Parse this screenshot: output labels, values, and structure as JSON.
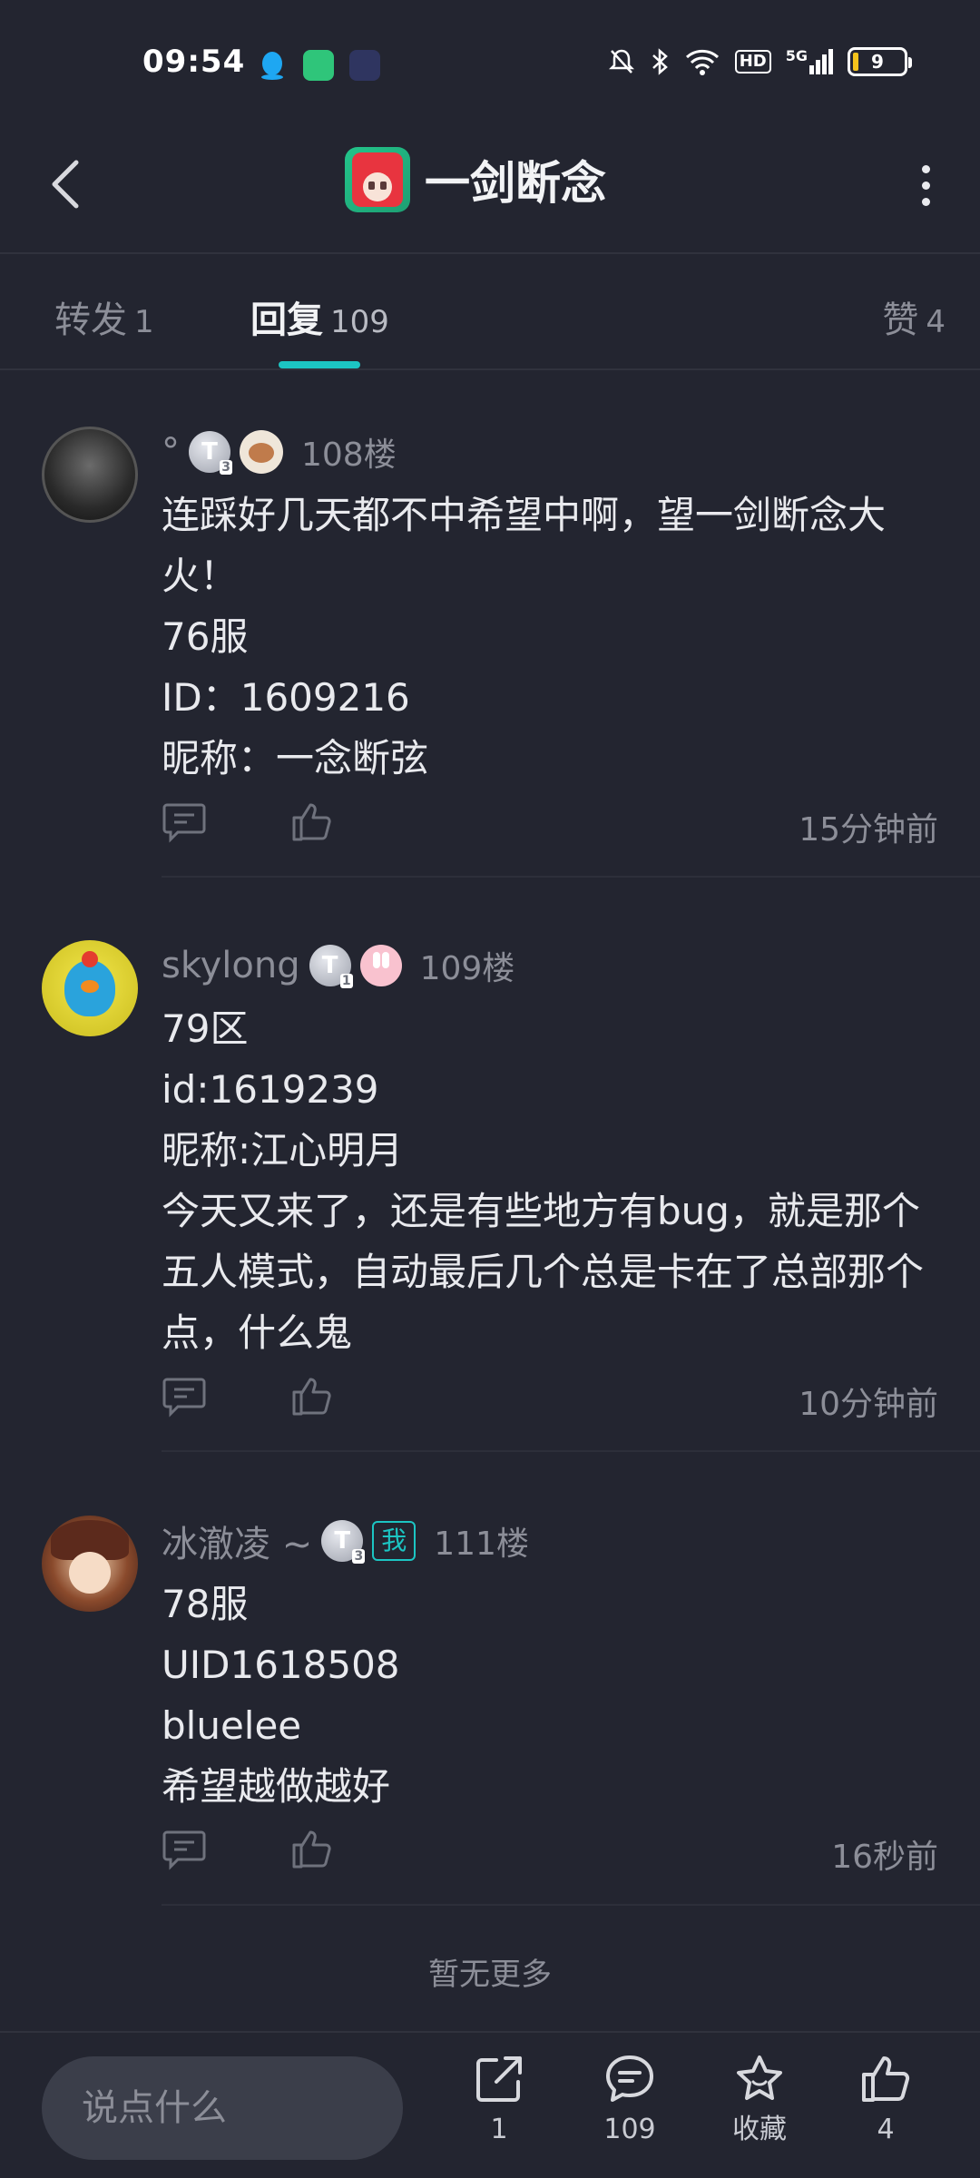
{
  "status_bar": {
    "time": "09:54",
    "hd": "HD",
    "network": "5G",
    "battery": "9"
  },
  "header": {
    "title": "一剑断念"
  },
  "tabs": [
    {
      "label": "转发",
      "count": "1"
    },
    {
      "label": "回复",
      "count": "109"
    },
    {
      "label": "赞",
      "count": "4"
    }
  ],
  "comments": [
    {
      "username": "°",
      "badge": "T",
      "badge_level": "3",
      "floor": "108楼",
      "lines": [
        "连踩好几天都不中希望中啊，望一剑断念大",
        "火！",
        "76服",
        "ID：1609216",
        "昵称：一念断弦"
      ],
      "time": "15分钟前"
    },
    {
      "username": "skylong",
      "badge": "T",
      "badge_level": "1",
      "floor": "109楼",
      "lines": [
        "79区",
        "id:1619239",
        "昵称:江心明月",
        "今天又来了，还是有些地方有bug，就是那个",
        "五人模式，自动最后几个总是卡在了总部那个",
        "点，什么鬼"
      ],
      "time": "10分钟前"
    },
    {
      "username": "冰澈凌 ~",
      "badge": "T",
      "badge_level": "3",
      "me_label": "我",
      "floor": "111楼",
      "lines": [
        "78服",
        "UID1618508",
        "bluelee",
        "希望越做越好"
      ],
      "time": "16秒前"
    }
  ],
  "no_more_text": "暂无更多",
  "bottom_bar": {
    "input_placeholder": "说点什么",
    "share_count": "1",
    "comment_count": "109",
    "favorite_label": "收藏",
    "like_count": "4"
  },
  "colors": {
    "background": "#232530",
    "accent": "#1cc5c3",
    "muted_text": "#8c8e98"
  }
}
